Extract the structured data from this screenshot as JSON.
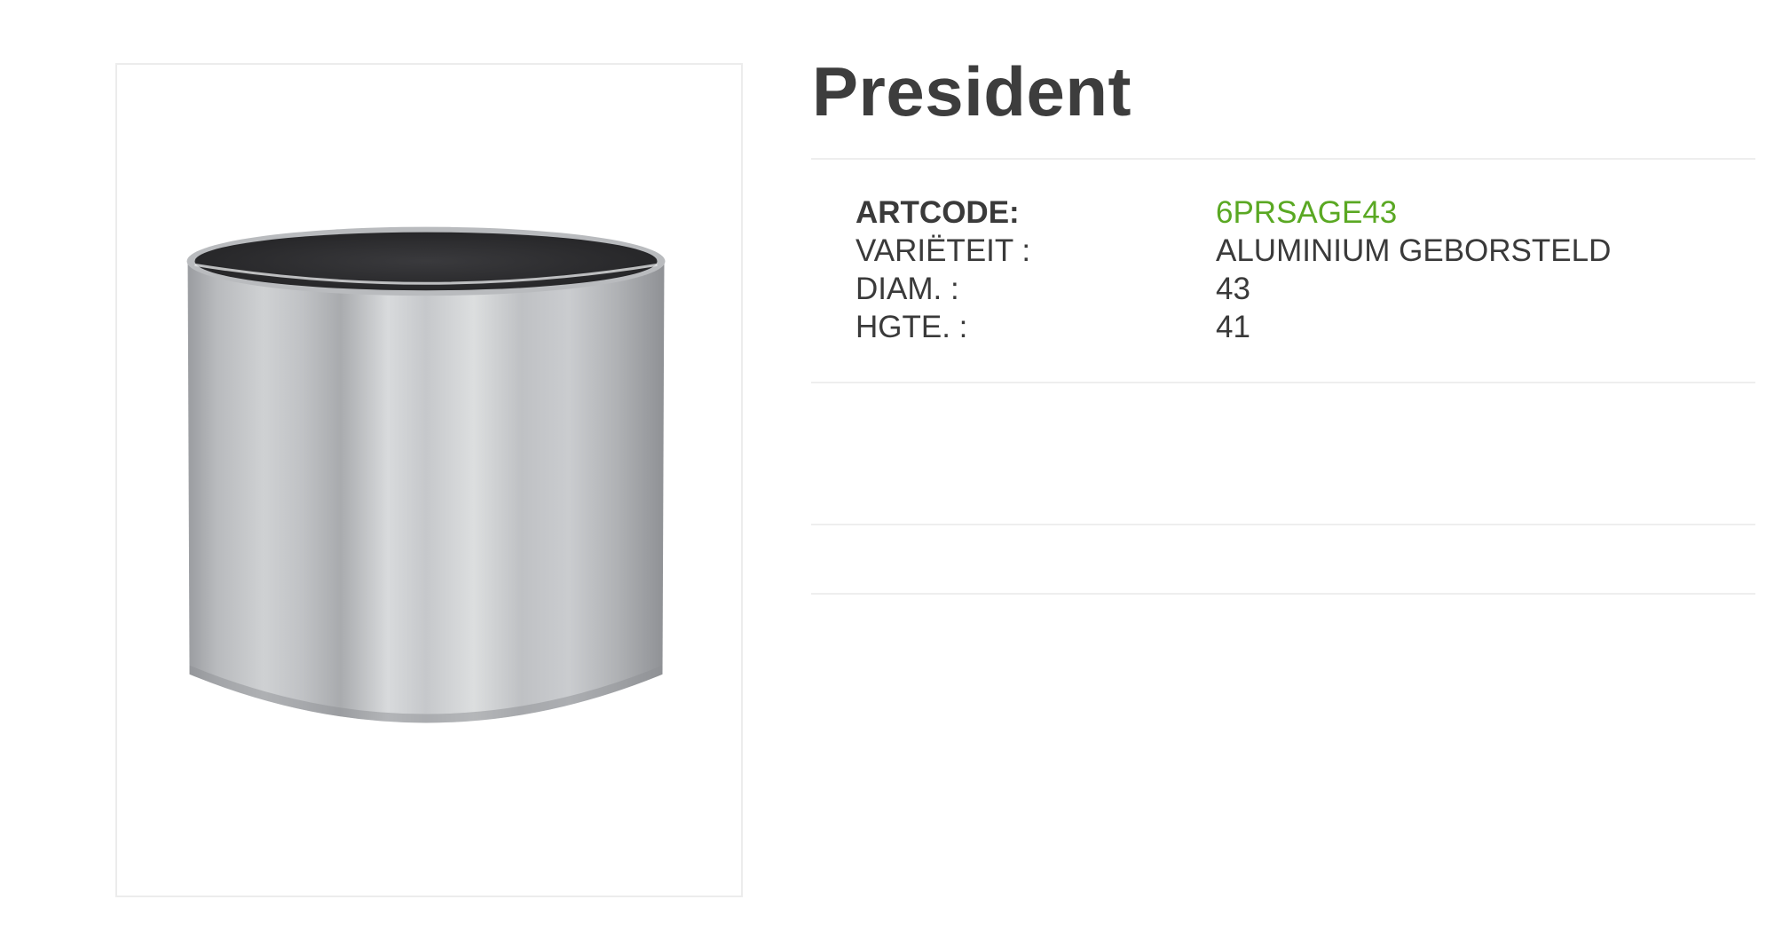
{
  "product": {
    "title": "President"
  },
  "specs": [
    {
      "label": "ARTCODE:",
      "value": "6PRSAGE43"
    },
    {
      "label": "VARIËTEIT :",
      "value": "ALUMINIUM GEBORSTELD"
    },
    {
      "label": "DIAM. :",
      "value": "43"
    },
    {
      "label": "HGTE. :",
      "value": "41"
    }
  ],
  "colors": {
    "accent": "#5aa823",
    "text": "#3a3a3a"
  }
}
